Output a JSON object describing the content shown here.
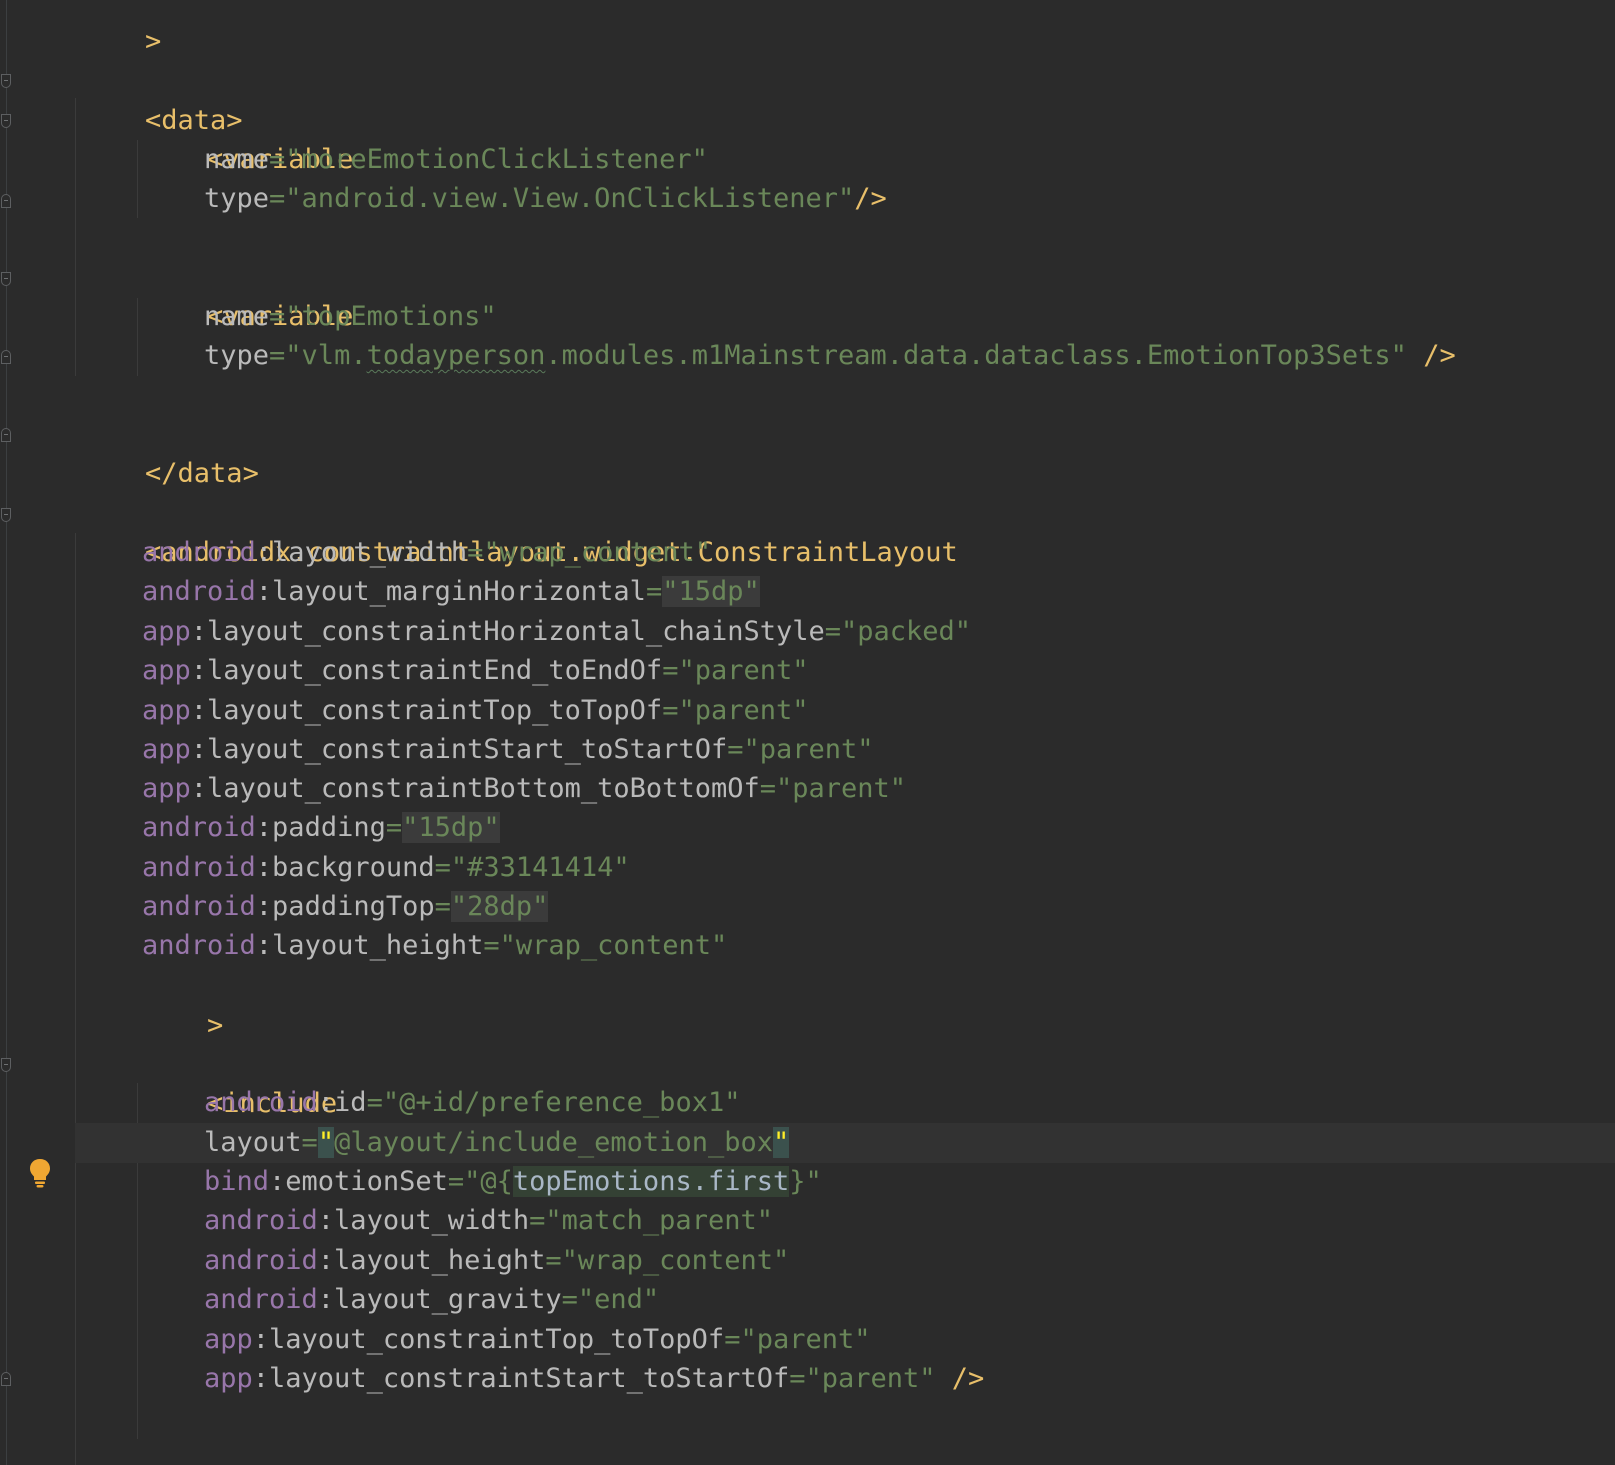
{
  "editor": {
    "language": "xml",
    "theme_background": "#2b2b2b",
    "colors": {
      "tag": "#e8bf6a",
      "namespace": "#9876aa",
      "attribute": "#bababa",
      "string": "#6a8759"
    },
    "gutter_icon": "lightbulb-icon",
    "lines": {
      "l0": ">",
      "l1_tag": "<data>",
      "l2_tag": "<variable",
      "l3_attr": "name",
      "l3_val": "\"moreEmotionClickListener\"",
      "l4_attr": "type",
      "l4_val": "\"android.view.View.OnClickListener\"",
      "l4_close": "/>",
      "l5_tag": "<variable",
      "l6_attr": "name",
      "l6_val": "\"topEmotions\"",
      "l7_attr": "type",
      "l7_val_a": "\"vlm.",
      "l7_val_typo": "todayperson",
      "l7_val_b": ".modules.m1Mainstream.data.dataclass.EmotionTop3Sets\"",
      "l7_close": " />",
      "l8_tag": "</data>",
      "l9_tag": "<androidx.constraintlayout.widget.ConstraintLayout",
      "l10_ns": "android",
      "l10_attr": ":layout_width",
      "l10_val": "\"wrap_content\"",
      "l11_ns": "android",
      "l11_attr": ":layout_marginHorizontal",
      "l11_val": "\"15dp\"",
      "l12_ns": "app",
      "l12_attr": ":layout_constraintHorizontal_chainStyle",
      "l12_val": "\"packed\"",
      "l13_ns": "app",
      "l13_attr": ":layout_constraintEnd_toEndOf",
      "l13_val": "\"parent\"",
      "l14_ns": "app",
      "l14_attr": ":layout_constraintTop_toTopOf",
      "l14_val": "\"parent\"",
      "l15_ns": "app",
      "l15_attr": ":layout_constraintStart_toStartOf",
      "l15_val": "\"parent\"",
      "l16_ns": "app",
      "l16_attr": ":layout_constraintBottom_toBottomOf",
      "l16_val": "\"parent\"",
      "l17_ns": "android",
      "l17_attr": ":padding",
      "l17_val": "\"15dp\"",
      "l18_ns": "android",
      "l18_attr": ":background",
      "l18_val": "\"#33141414\"",
      "l19_ns": "android",
      "l19_attr": ":paddingTop",
      "l19_val": "\"28dp\"",
      "l20_ns": "android",
      "l20_attr": ":layout_height",
      "l20_val": "\"wrap_content\"",
      "l21": ">",
      "l22_tag": "<include",
      "l23_ns": "android",
      "l23_attr": ":id",
      "l23_val": "\"@+id/preference_box1\"",
      "l24_attr": "layout",
      "l24_q1": "\"",
      "l24_val": "@layout/include_emotion_box",
      "l24_q2": "\"",
      "l25_ns": "bind",
      "l25_attr": ":emotionSet",
      "l25_val_a": "\"@{",
      "l25_val_ref": "topEmotions.first",
      "l25_val_b": "}\"",
      "l26_ns": "android",
      "l26_attr": ":layout_width",
      "l26_val": "\"match_parent\"",
      "l27_ns": "android",
      "l27_attr": ":layout_height",
      "l27_val": "\"wrap_content\"",
      "l28_ns": "android",
      "l28_attr": ":layout_gravity",
      "l28_val": "\"end\"",
      "l29_ns": "app",
      "l29_attr": ":layout_constraintTop_toTopOf",
      "l29_val": "\"parent\"",
      "l30_ns": "app",
      "l30_attr": ":layout_constraintStart_toStartOf",
      "l30_val": "\"parent\"",
      "l30_close": " />"
    }
  }
}
